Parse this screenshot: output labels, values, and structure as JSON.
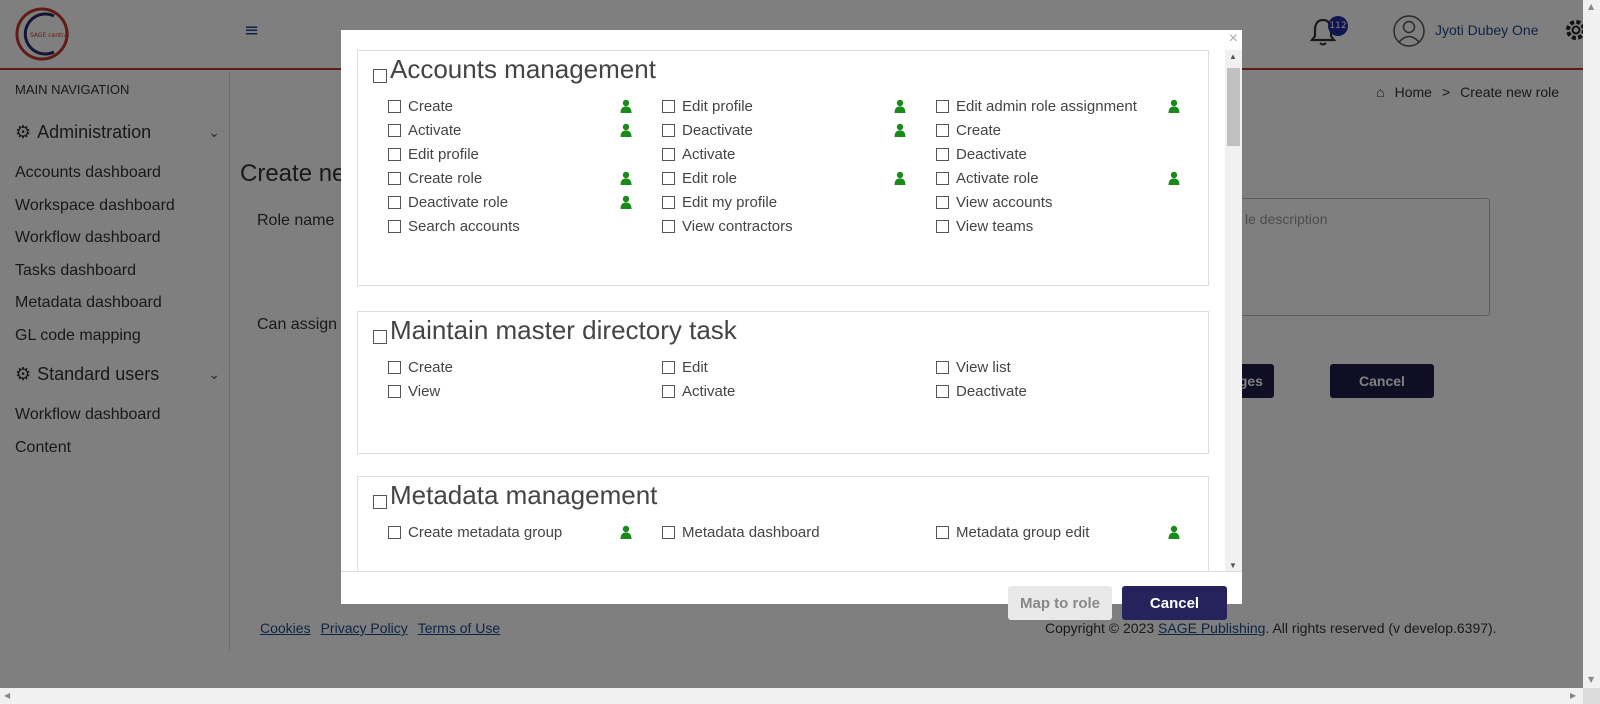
{
  "header": {
    "logo_text": "SAGE central",
    "notification_count": "112",
    "user_name": "Jyoti Dubey One"
  },
  "sidebar": {
    "heading": "MAIN NAVIGATION",
    "groups": [
      {
        "label": "Administration",
        "items": [
          "Accounts dashboard",
          "Workspace dashboard",
          "Workflow dashboard",
          "Tasks dashboard",
          "Metadata dashboard",
          "GL code mapping"
        ]
      },
      {
        "label": "Standard users",
        "items": [
          "Workflow dashboard",
          "Content"
        ]
      }
    ]
  },
  "breadcrumb": {
    "home": "Home",
    "separator": ">",
    "current": "Create new role"
  },
  "page": {
    "title_partial": "Create ne",
    "role_name_label_partial": "Role name",
    "can_assign_label_partial": "Can assign",
    "description_placeholder_partial": "le description",
    "privileges_button_partial": "eges",
    "cancel_button": "Cancel"
  },
  "footer": {
    "links": [
      "Cookies",
      "Privacy Policy",
      "Terms of Use"
    ],
    "copyright_prefix": "Copyright © 2023 ",
    "copyright_link": "SAGE Publishing",
    "copyright_suffix": ". All rights reserved (v develop.6397)."
  },
  "modal": {
    "close_symbol": "×",
    "sections": [
      {
        "title": "Accounts management",
        "columns": [
          [
            "Create",
            "Activate",
            "Edit profile",
            "Create role",
            "Deactivate role",
            "Search accounts"
          ],
          [
            "Edit profile",
            "Deactivate",
            "Activate",
            "Edit role",
            "Edit my profile",
            "View contractors"
          ],
          [
            "Edit admin role assignment",
            "Create",
            "Deactivate",
            "Activate role",
            "View accounts",
            "View teams"
          ]
        ]
      },
      {
        "title": "Maintain master directory task",
        "columns": [
          [
            "Create",
            "View"
          ],
          [
            "Edit",
            "Activate"
          ],
          [
            "View list",
            "Deactivate"
          ]
        ]
      },
      {
        "title": "Metadata management",
        "columns": [
          [
            "Create metadata group"
          ],
          [
            "Metadata dashboard"
          ],
          [
            "Metadata group edit"
          ]
        ]
      }
    ],
    "map_button": "Map to role",
    "cancel_button": "Cancel"
  },
  "colors": {
    "accent_red": "#c0392b",
    "navy": "#26235c",
    "user_icon_green": "#1a8a1a",
    "link_blue": "#1a4a8a"
  }
}
